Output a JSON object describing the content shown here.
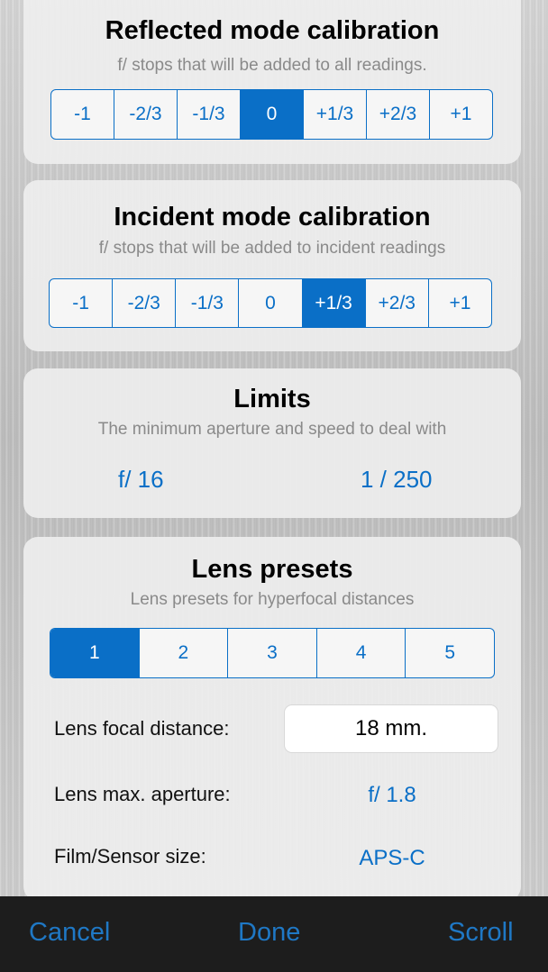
{
  "reflected": {
    "title": "Reflected mode calibration",
    "subtitle": "f/ stops that will be added to all readings.",
    "options": [
      "-1",
      "-2/3",
      "-1/3",
      "0",
      "+1/3",
      "+2/3",
      "+1"
    ],
    "selected_index": 3
  },
  "incident": {
    "title": "Incident mode calibration",
    "subtitle": "f/ stops that will be added to incident readings",
    "options": [
      "-1",
      "-2/3",
      "-1/3",
      "0",
      "+1/3",
      "+2/3",
      "+1"
    ],
    "selected_index": 4
  },
  "limits": {
    "title": "Limits",
    "subtitle": "The minimum aperture and speed to deal with",
    "aperture": "f/ 16",
    "speed": "1 / 250"
  },
  "lens": {
    "title": "Lens presets",
    "subtitle": "Lens presets for hyperfocal distances",
    "presets": [
      "1",
      "2",
      "3",
      "4",
      "5"
    ],
    "selected_index": 0,
    "focal_label": "Lens focal distance:",
    "focal_value": "18 mm.",
    "aperture_label": "Lens max. aperture:",
    "aperture_value": "f/ 1.8",
    "sensor_label": "Film/Sensor size:",
    "sensor_value": "APS-C"
  },
  "toolbar": {
    "cancel": "Cancel",
    "done": "Done",
    "scroll": "Scroll"
  },
  "colors": {
    "accent": "#0a6fc7",
    "toolbar_bg": "#1d1d1d"
  }
}
